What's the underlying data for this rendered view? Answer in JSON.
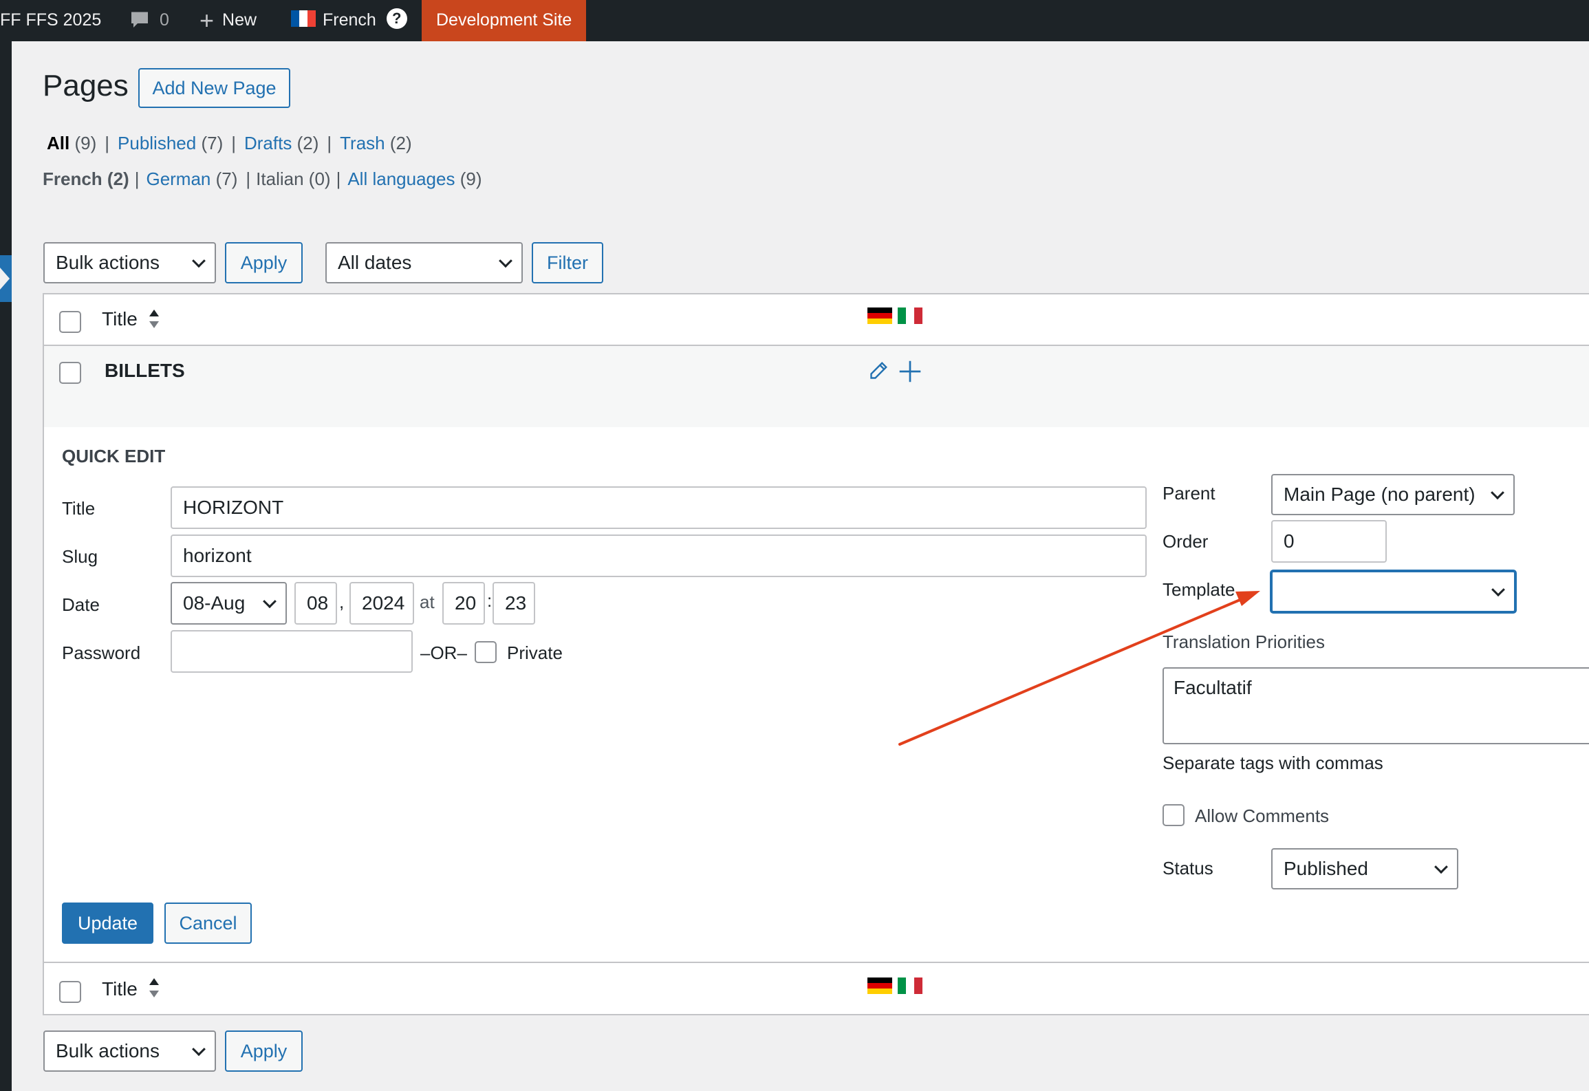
{
  "adminbar": {
    "site_name": "FF FFS 2025",
    "comments_count": "0",
    "new_label": "New",
    "language": "French",
    "dev_site": "Development Site"
  },
  "page": {
    "title": "Pages",
    "add_new": "Add New Page"
  },
  "status_filters": [
    {
      "label": "All",
      "count": "(9)"
    },
    {
      "label": "Published",
      "count": "(7)"
    },
    {
      "label": "Drafts",
      "count": "(2)"
    },
    {
      "label": "Trash",
      "count": "(2)"
    }
  ],
  "language_filters": [
    {
      "label": "French",
      "count": "(2)"
    },
    {
      "label": "German",
      "count": "(7)"
    },
    {
      "label": "Italian",
      "count": "(0)"
    },
    {
      "label": "All languages",
      "count": "(9)"
    }
  ],
  "toolbar": {
    "bulk_actions": "Bulk actions",
    "apply": "Apply",
    "all_dates": "All dates",
    "filter": "Filter"
  },
  "table": {
    "col_title": "Title",
    "row_title": "BILLETS"
  },
  "quick_edit": {
    "heading": "QUICK EDIT",
    "title_label": "Title",
    "title_value": "HORIZONT",
    "slug_label": "Slug",
    "slug_value": "horizont",
    "date_label": "Date",
    "month_value": "08-Aug",
    "day_value": "08",
    "comma": ",",
    "year_value": "2024",
    "at": "at",
    "hour_value": "20",
    "colon": ":",
    "minute_value": "23",
    "password_label": "Password",
    "or": "–OR–",
    "private_label": "Private",
    "parent_label": "Parent",
    "parent_value": "Main Page (no parent)",
    "order_label": "Order",
    "order_value": "0",
    "template_label": "Template",
    "template_value": "",
    "priorities_label": "Translation Priorities",
    "priorities_value": "Facultatif",
    "tags_hint": "Separate tags with commas",
    "allow_comments_label": "Allow Comments",
    "status_label": "Status",
    "status_value": "Published",
    "update": "Update",
    "cancel": "Cancel"
  },
  "colors": {
    "accent": "#2271b1",
    "dev_site": "#c9461d",
    "annotation_arrow": "#e2401c"
  }
}
